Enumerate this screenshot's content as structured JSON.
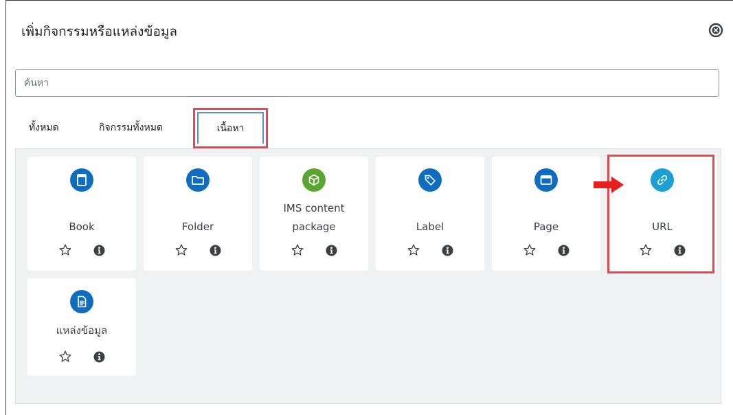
{
  "modal": {
    "title": "เพิ่มกิจกรรมหรือแหล่งข้อมูล",
    "close_icon": "close-circle-icon"
  },
  "search": {
    "placeholder": "ค้นหา",
    "value": ""
  },
  "tabs": [
    {
      "label": "ทั้งหมด",
      "active": false
    },
    {
      "label": "กิจกรรมทั้งหมด",
      "active": false
    },
    {
      "label": "เนื้อหา",
      "active": true
    }
  ],
  "cards": [
    {
      "name": "Book",
      "icon": "book-icon",
      "color": "#0f6cbf"
    },
    {
      "name": "Folder",
      "icon": "folder-icon",
      "color": "#0f6cbf"
    },
    {
      "name_line1": "IMS content",
      "name_line2": "package",
      "icon": "package-cube-icon",
      "color": "#5aa532"
    },
    {
      "name": "Label",
      "icon": "tag-icon",
      "color": "#0f6cbf"
    },
    {
      "name": "Page",
      "icon": "page-window-icon",
      "color": "#0f6cbf"
    },
    {
      "name": "URL",
      "icon": "link-icon",
      "color": "#1c9fd1",
      "highlighted": true
    },
    {
      "name": "แหล่งข้อมูล",
      "icon": "file-document-icon",
      "color": "#0f6cbf"
    }
  ],
  "card_actions": {
    "star_icon": "star-outline-icon",
    "info_icon": "info-circle-icon"
  },
  "annotation": {
    "arrow_icon": "red-arrow-icon",
    "highlight_color": "#e8464a"
  },
  "colors": {
    "primary": "#0f6cbf",
    "panel_bg": "#f0f1f3",
    "tab_border": "#5b8ecf"
  }
}
